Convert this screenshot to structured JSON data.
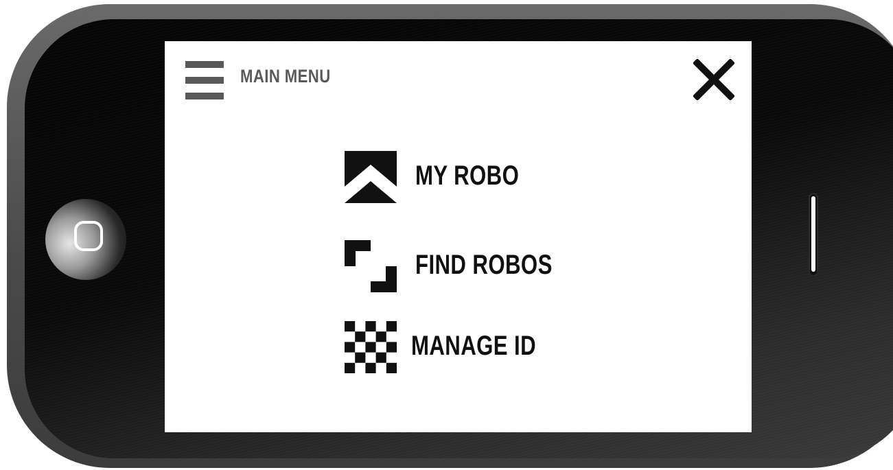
{
  "menu": {
    "title": "MAIN MENU",
    "items": [
      {
        "label": "MY ROBO",
        "icon": "chevron-up-icon"
      },
      {
        "label": "FIND ROBOS",
        "icon": "frame-corners-icon"
      },
      {
        "label": "MANAGE ID",
        "icon": "checkerboard-icon"
      }
    ]
  },
  "colors": {
    "screen_background": "#ffffff",
    "menu_text": "#111111",
    "header_text": "#5a5a5a",
    "phone_body": "#4a4a4a",
    "bezel": "#0a0a0a"
  }
}
